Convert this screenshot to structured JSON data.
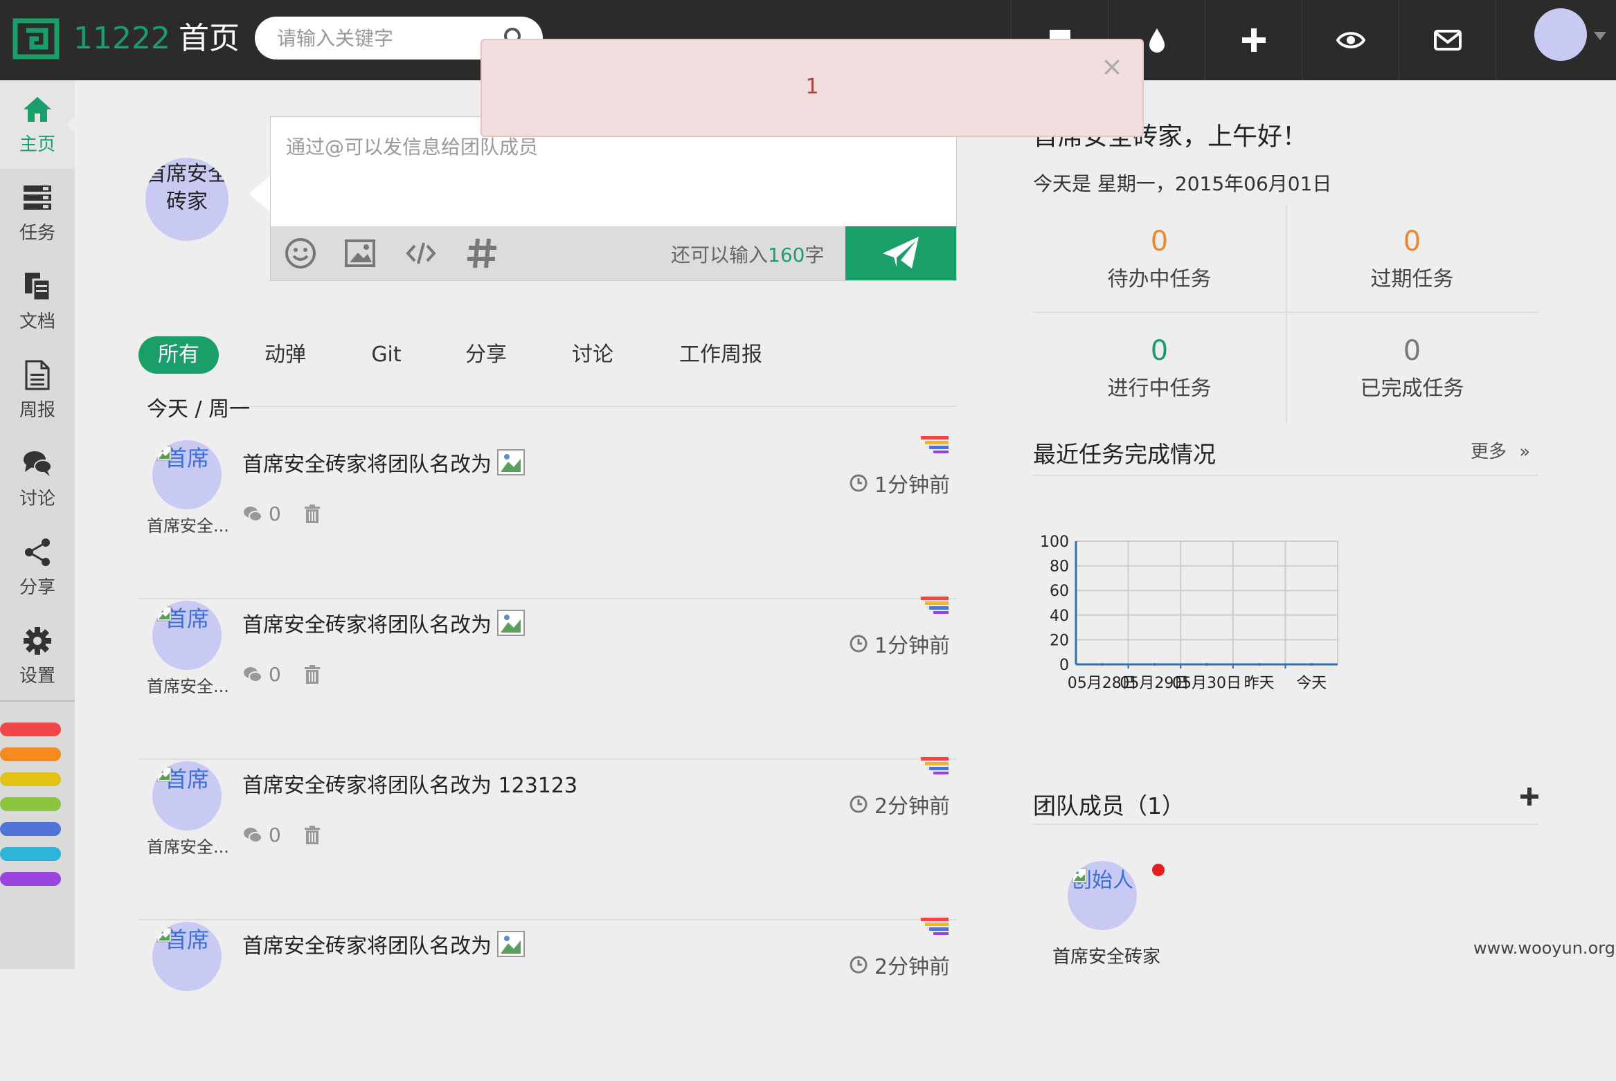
{
  "header": {
    "logo_text": "11222",
    "home_label": "首页",
    "search_placeholder": "请输入关键字",
    "nav_icons": [
      "square-icon",
      "water-drop-icon",
      "plus-icon",
      "eye-icon",
      "mail-icon"
    ]
  },
  "alert": {
    "message": "1",
    "close_symbol": "×"
  },
  "sidebar": {
    "items": [
      {
        "label": "主页",
        "icon": "home-icon"
      },
      {
        "label": "任务",
        "icon": "tasks-icon"
      },
      {
        "label": "文档",
        "icon": "documents-icon"
      },
      {
        "label": "周报",
        "icon": "report-icon"
      },
      {
        "label": "讨论",
        "icon": "chat-icon"
      },
      {
        "label": "分享",
        "icon": "share-icon"
      },
      {
        "label": "设置",
        "icon": "gear-icon"
      }
    ],
    "colors": [
      "#f04848",
      "#f58a1f",
      "#e3c214",
      "#8cc43f",
      "#4f73d6",
      "#2db4d8",
      "#9b44e0"
    ]
  },
  "composer": {
    "avatar_alt": "首席安全砖家",
    "placeholder": "通过@可以发信息给团队成员",
    "counter_prefix": "还可以输入",
    "counter_num": "160",
    "counter_suffix": "字",
    "tools": [
      "smile-icon",
      "image-icon",
      "code-icon",
      "hash-icon"
    ]
  },
  "tabs": [
    "所有",
    "动弹",
    "Git",
    "分享",
    "讨论",
    "工作周报"
  ],
  "feed": {
    "day_label": "今天 / 周一",
    "items": [
      {
        "avatar_alt": "首席",
        "name": "首席安全...",
        "text": "首席安全砖家将团队名改为",
        "has_image": true,
        "comments": "0",
        "time": "1分钟前"
      },
      {
        "avatar_alt": "首席",
        "name": "首席安全...",
        "text": "首席安全砖家将团队名改为",
        "has_image": true,
        "comments": "0",
        "time": "1分钟前"
      },
      {
        "avatar_alt": "首席",
        "name": "首席安全...",
        "text": "首席安全砖家将团队名改为 123123",
        "has_image": false,
        "comments": "0",
        "time": "2分钟前"
      },
      {
        "avatar_alt": "首席",
        "name": "",
        "text": "首席安全砖家将团队名改为",
        "has_image": true,
        "comments": "",
        "time": "2分钟前"
      }
    ]
  },
  "right": {
    "greeting": "首席安全砖家，上午好！",
    "date": "今天是 星期一，2015年06月01日",
    "stats": [
      {
        "value": "0",
        "label": "待办中任务",
        "color": "#f0872a"
      },
      {
        "value": "0",
        "label": "过期任务",
        "color": "#f0872a"
      },
      {
        "value": "0",
        "label": "进行中任务",
        "color": "#1a9e6a"
      },
      {
        "value": "0",
        "label": "已完成任务",
        "color": "#777777"
      }
    ],
    "chart_title": "最近任务完成情况",
    "more_label": "更多",
    "members_title": "团队成员（1）",
    "member": {
      "avatar_alt": "创始人",
      "name": "首席安全砖家",
      "online": true
    }
  },
  "chart_data": {
    "type": "line",
    "categories": [
      "05月28日",
      "05月29日",
      "05月30日",
      "昨天",
      "今天"
    ],
    "series": [
      {
        "values": [
          0,
          0,
          0,
          0,
          0
        ]
      }
    ],
    "ylim": [
      0,
      100
    ],
    "yticks": [
      0,
      20,
      40,
      60,
      80,
      100
    ],
    "grid": true,
    "line_color": "#3070b0"
  },
  "watermark": "www.wooyun.org"
}
